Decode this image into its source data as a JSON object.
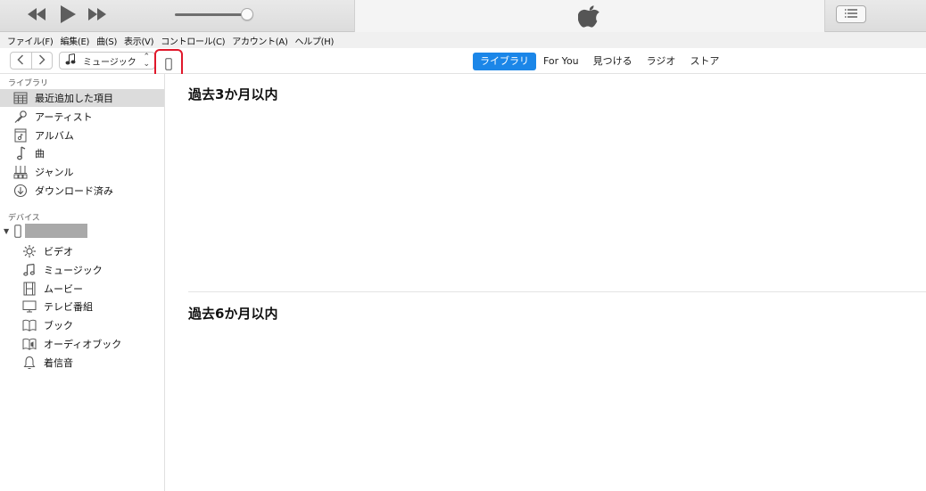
{
  "player": {
    "prev_icon": "rewind-icon",
    "play_icon": "play-icon",
    "next_icon": "fast-forward-icon",
    "volume": 0.9,
    "logo_icon": "apple-logo-icon",
    "list_icon": "list-icon"
  },
  "menu": {
    "items": [
      "ファイル(F)",
      "編集(E)",
      "曲(S)",
      "表示(V)",
      "コントロール(C)",
      "アカウント(A)",
      "ヘルプ(H)"
    ]
  },
  "nav": {
    "back_icon": "chevron-left-icon",
    "forward_icon": "chevron-right-icon",
    "media_select": "ミュージック",
    "device_icon": "iphone-icon",
    "device_highlight_color": "#e0182b",
    "tabs": [
      "ライブラリ",
      "For You",
      "見つける",
      "ラジオ",
      "ストア"
    ],
    "active_tab": "ライブラリ",
    "accent_color": "#1b86e8"
  },
  "sidebar": {
    "library_label": "ライブラリ",
    "library_items": [
      "最近追加した項目",
      "アーティスト",
      "アルバム",
      "曲",
      "ジャンル",
      "ダウンロード済み"
    ],
    "devices_label": "デバイス",
    "device_items": [
      "ビデオ",
      "ミュージック",
      "ムービー",
      "テレビ番組",
      "ブック",
      "オーディオブック",
      "着信音"
    ]
  },
  "main": {
    "section1_title": "過去3か月以内",
    "section2_title": "過去6か月以内"
  }
}
